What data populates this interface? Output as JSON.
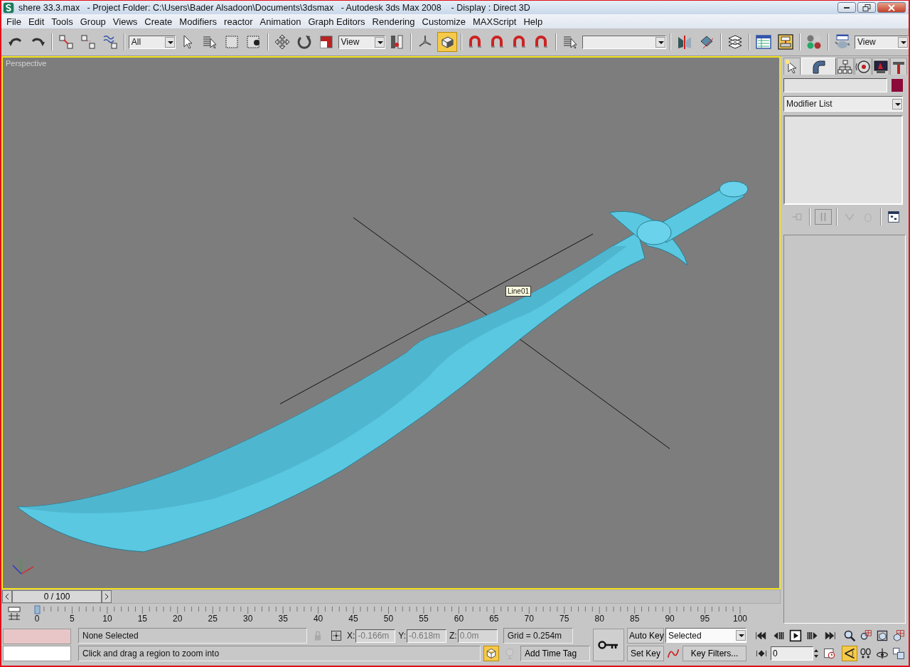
{
  "window": {
    "title": "shere 33.3.max   - Project Folder: C:\\Users\\Bader Alsadoon\\Documents\\3dsmax   - Autodesk 3ds Max 2008    - Display : Direct 3D"
  },
  "menu": [
    "File",
    "Edit",
    "Tools",
    "Group",
    "Views",
    "Create",
    "Modifiers",
    "reactor",
    "Animation",
    "Graph Editors",
    "Rendering",
    "Customize",
    "MAXScript",
    "Help"
  ],
  "toolbar": {
    "selection_filter": "All",
    "reference_coordinate": "View",
    "keyboard_override_on": true,
    "render_view": "View"
  },
  "viewport": {
    "label": "Perspective",
    "tooltip": "Line01"
  },
  "command_panel": {
    "tabs": [
      {
        "selected": false
      },
      {
        "selected": true
      },
      {
        "selected": false
      },
      {
        "selected": false
      },
      {
        "selected": false
      },
      {
        "selected": false
      }
    ],
    "modifier_list": "Modifier List"
  },
  "timeline": {
    "slider": "0 / 100",
    "level": 0,
    "frames": [
      "0",
      "5",
      "10",
      "15",
      "20",
      "25",
      "30",
      "35",
      "40",
      "45",
      "50",
      "55",
      "60",
      "65",
      "70",
      "75",
      "80",
      "85",
      "90",
      "95",
      "100"
    ]
  },
  "status": {
    "selection": "None Selected",
    "prompt": "Click and drag a region to zoom into",
    "x_label": "X:",
    "x": "-0.166m",
    "y_label": "Y:",
    "y": "-0.618m",
    "z_label": "Z:",
    "z": "0.0m",
    "grid": "Grid = 0.254m",
    "time_tag": "Add Time Tag",
    "adaptive_degradation_on": true
  },
  "animation": {
    "auto_key": "Auto Key",
    "set_key": "Set Key",
    "key_mode": "Selected",
    "key_filters": "Key Filters...",
    "frame": "0"
  },
  "navigation": {
    "zoom_region_on": true
  }
}
